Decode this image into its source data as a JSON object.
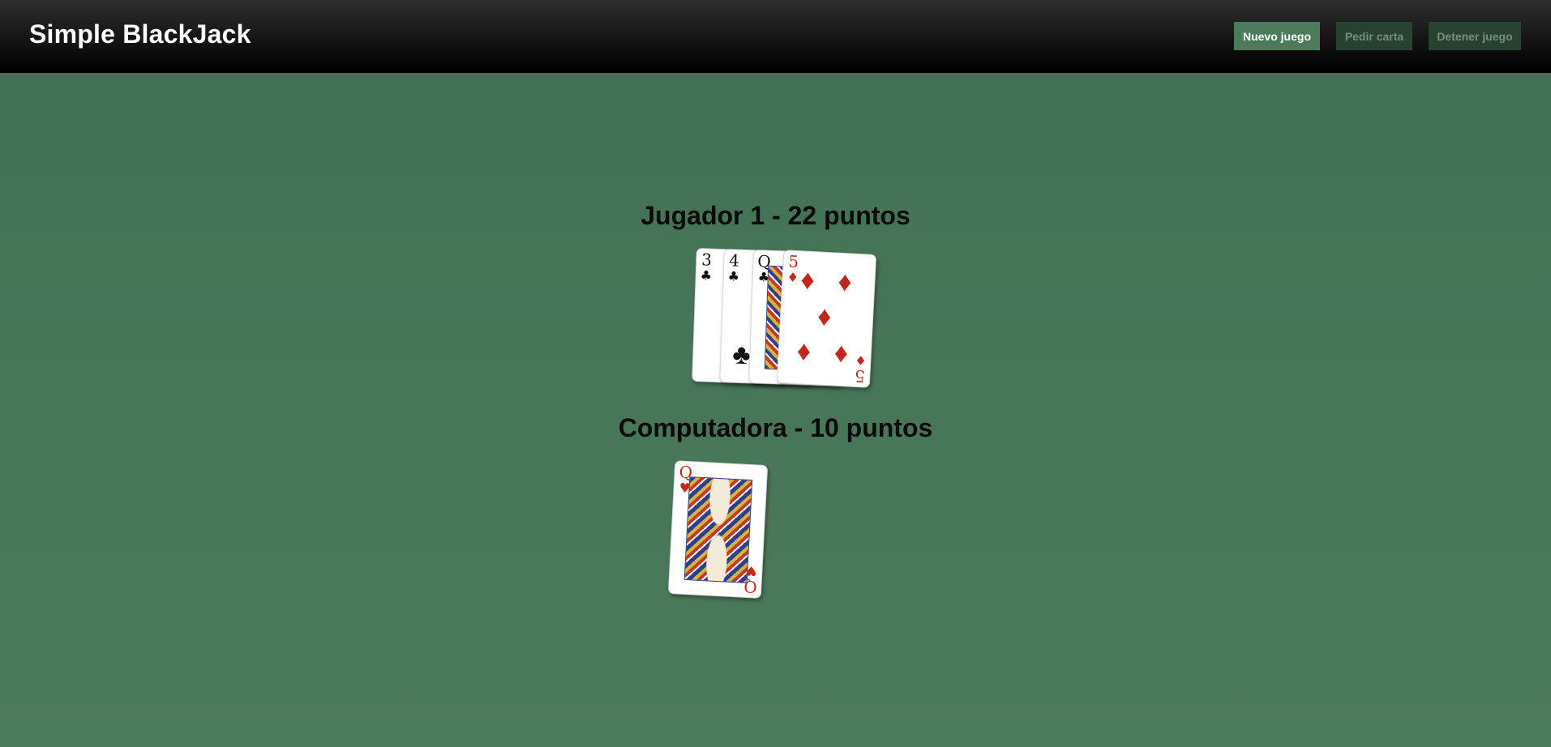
{
  "header": {
    "brand": "Simple BlackJack",
    "buttons": {
      "new_game": "Nuevo juego",
      "hit": "Pedir carta",
      "stop": "Detener juego"
    }
  },
  "player": {
    "title": "Jugador 1 - 22 puntos",
    "cards": [
      {
        "rank": "3",
        "suit": "♣",
        "color": "black"
      },
      {
        "rank": "4",
        "suit": "♣",
        "color": "black"
      },
      {
        "rank": "Q",
        "suit": "♣",
        "color": "black"
      },
      {
        "rank": "5",
        "suit": "♦",
        "color": "red"
      }
    ]
  },
  "computer": {
    "title": "Computadora - 10 puntos",
    "cards": [
      {
        "rank": "Q",
        "suit": "♥",
        "color": "red"
      }
    ]
  },
  "colors": {
    "table": "#467657",
    "primary_button": "#4a7c5c",
    "disabled_button": "#27422f",
    "red_suit": "#c0281c"
  }
}
